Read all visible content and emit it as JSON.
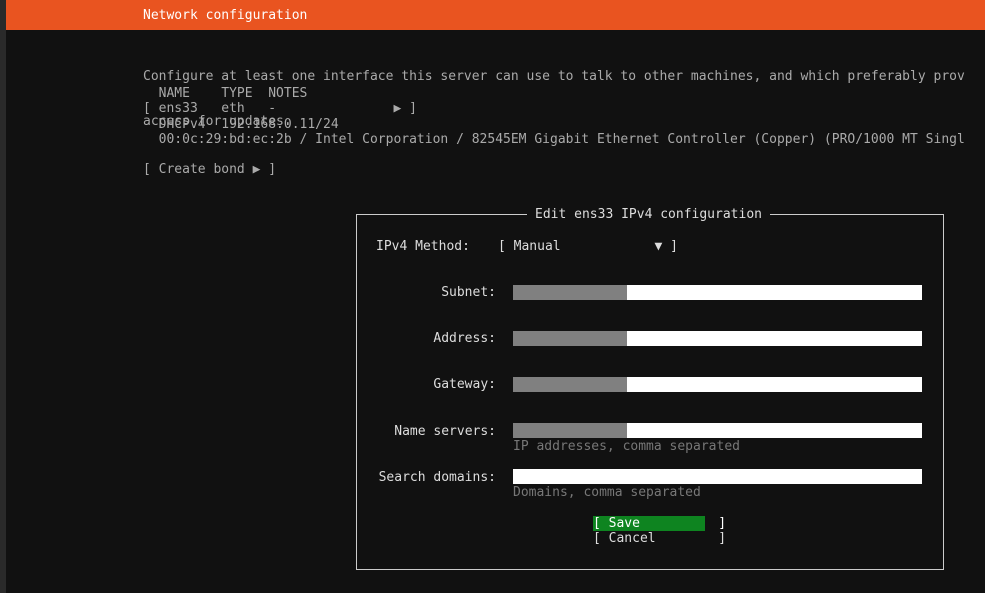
{
  "header": {
    "title": "Network configuration"
  },
  "intro": {
    "line1": "Configure at least one interface this server can use to talk to other machines, and which preferably prov",
    "line2": "access for updates."
  },
  "interfaces": {
    "columns": "  NAME    TYPE  NOTES",
    "ens33_row": "[ ens33   eth   -               ▶ ]",
    "dhcp_row": "  DHCPv4  192.168.0.11/24",
    "mac_row": "  00:0c:29:bd:ec:2b / Intel Corporation / 82545EM Gigabit Ethernet Controller (Copper) (PRO/1000 MT Singl"
  },
  "create_bond": "[ Create bond ▶ ]",
  "dialog": {
    "title": "Edit ens33 IPv4 configuration",
    "method_label": "IPv4 Method:",
    "method_value": "[ Manual            ▼ ]",
    "subnet_label": "Subnet:",
    "address_label": "Address:",
    "gateway_label": "Gateway:",
    "nameservers_label": "Name servers:",
    "nameservers_hint": "IP addresses, comma separated",
    "search_label": "Search domains:",
    "search_hint": "Domains, comma separated",
    "save": "[ Save          ]",
    "cancel": "[ Cancel        ]"
  },
  "colors": {
    "header_bg": "#e95420",
    "save_bg": "#0e8420",
    "background": "#111111"
  }
}
